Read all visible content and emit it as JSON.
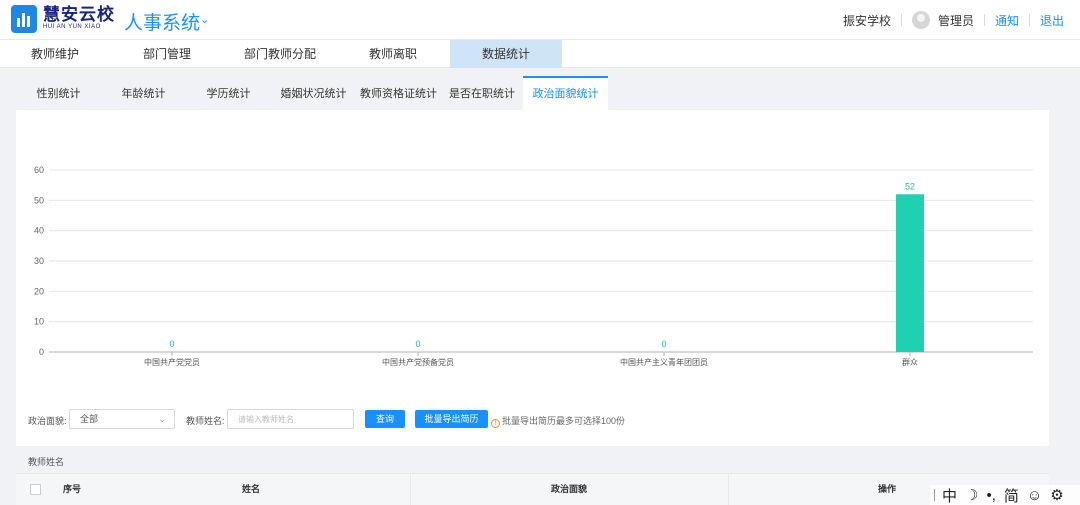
{
  "header": {
    "logo_title": "慧安云校",
    "logo_subtitle": "HUI AN YUN XIAO",
    "system_title": "人事系统",
    "school": "振安学校",
    "user": "管理员",
    "notify": "通知",
    "logout": "退出"
  },
  "main_nav": [
    "教师维护",
    "部门管理",
    "部门教师分配",
    "教师离职",
    "数据统计"
  ],
  "sub_tabs": [
    "性别统计",
    "年龄统计",
    "学历统计",
    "婚姻状况统计",
    "教师资格证统计",
    "是否在职统计",
    "政治面貌统计"
  ],
  "chart_data": {
    "type": "bar",
    "categories": [
      "中国共产党党员",
      "中国共产党预备党员",
      "中国共产主义青年团团员",
      "群众"
    ],
    "values": [
      0,
      0,
      0,
      52
    ],
    "ylim": [
      0,
      60
    ],
    "yticks": [
      0,
      10,
      20,
      30,
      40,
      50,
      60
    ],
    "grid": true,
    "bar_color": "#1fd1b0",
    "label_color": "#1fbf9f"
  },
  "filters": {
    "political_label": "政治面貌:",
    "political_value": "全部",
    "name_label": "教师姓名:",
    "name_placeholder": "请输入教师姓名",
    "query_button": "查询",
    "export_button": "批量导出简历",
    "tip": "批量导出简历最多可选择100份"
  },
  "table": {
    "title": "教师姓名",
    "columns": [
      "序号",
      "姓名",
      "政治面貌",
      "操作"
    ]
  },
  "ime": {
    "items": [
      "中",
      "☽",
      "•,",
      "简",
      "☺",
      "⚙"
    ]
  },
  "colors": {
    "accent": "#1890ff",
    "brand": "#1a237e",
    "active_nav_bg": "#cfe4f7"
  }
}
